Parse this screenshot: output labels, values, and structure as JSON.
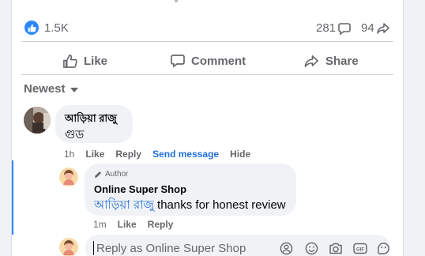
{
  "post_stats": {
    "reaction_count": "1.5K",
    "comment_count": "281",
    "share_count": "94"
  },
  "actions": {
    "like_label": "Like",
    "comment_label": "Comment",
    "share_label": "Share"
  },
  "sort": {
    "label": "Newest"
  },
  "comments": [
    {
      "author": "আড়িয়া রাজু",
      "text": "গুড",
      "time": "1h",
      "actions": [
        "Like",
        "Reply",
        "Send message",
        "Hide"
      ]
    }
  ],
  "reply": {
    "author_badge": "Author",
    "author": "Online Super Shop",
    "mention": "আড়িয়া রাজু",
    "text": " thanks for honest review",
    "time": "1m",
    "actions": [
      "Like",
      "Reply"
    ]
  },
  "composer": {
    "placeholder": "Reply as Online Super Shop"
  },
  "colors": {
    "accent": "#216fdb",
    "like_badge": "#2d88ff",
    "thread_line": "#2d88ff",
    "muted": "#65676b"
  }
}
